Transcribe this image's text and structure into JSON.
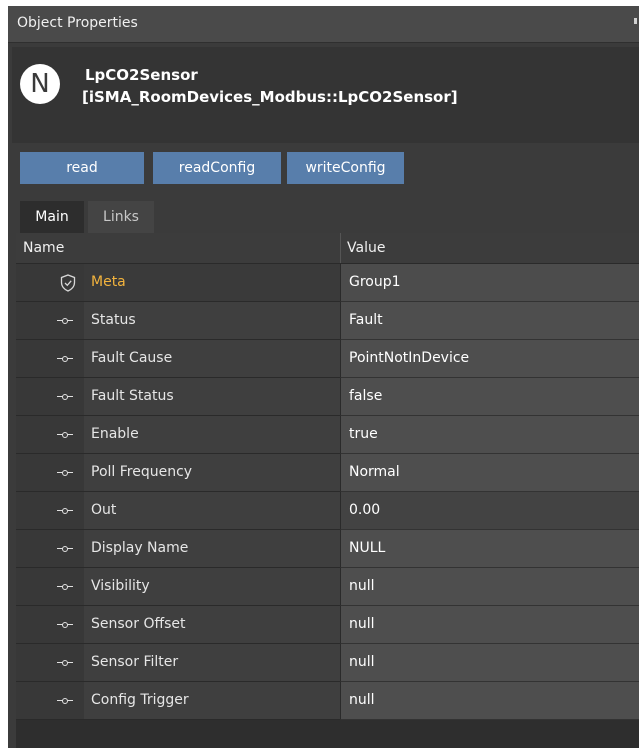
{
  "window": {
    "title": "Object Properties"
  },
  "object": {
    "badge_letter": "N",
    "name": "LpCO2Sensor",
    "type": "[iSMA_RoomDevices_Modbus::LpCO2Sensor]"
  },
  "actions": {
    "read_label": "read",
    "readconfig_label": "readConfig",
    "writeconfig_label": "writeConfig",
    "button_color": "#587eab"
  },
  "tabs": [
    {
      "label": "Main",
      "active": true
    },
    {
      "label": "Links",
      "active": false
    }
  ],
  "grid": {
    "columns": {
      "name": "Name",
      "value": "Value"
    },
    "rows": [
      {
        "icon": "shield-icon",
        "label": "Meta",
        "value": "Group1",
        "highlight_color": "#f2b33d"
      },
      {
        "icon": "slot-icon",
        "label": "Status",
        "value": "Fault"
      },
      {
        "icon": "slot-icon",
        "label": "Fault Cause",
        "value": "PointNotInDevice"
      },
      {
        "icon": "slot-icon",
        "label": "Fault Status",
        "value": "false"
      },
      {
        "icon": "slot-icon",
        "label": "Enable",
        "value": "true"
      },
      {
        "icon": "slot-icon",
        "label": "Poll Frequency",
        "value": "Normal"
      },
      {
        "icon": "slot-icon",
        "label": "Out",
        "value": "0.00"
      },
      {
        "icon": "slot-icon",
        "label": "Display Name",
        "value": "NULL"
      },
      {
        "icon": "slot-icon",
        "label": "Visibility",
        "value": "null"
      },
      {
        "icon": "slot-icon",
        "label": "Sensor Offset",
        "value": "null"
      },
      {
        "icon": "slot-icon",
        "label": "Sensor Filter",
        "value": "null"
      },
      {
        "icon": "slot-icon",
        "label": "Config Trigger",
        "value": "null"
      }
    ]
  }
}
